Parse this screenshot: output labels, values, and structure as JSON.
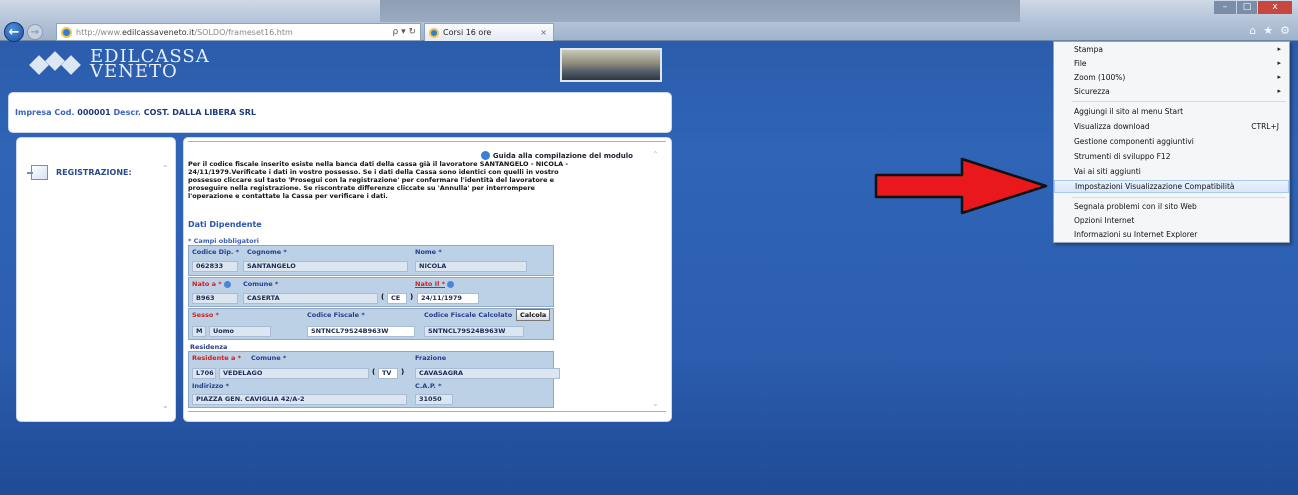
{
  "browser": {
    "url_domain": "edilcassaveneto.it",
    "url_prefix": "http://www.",
    "url_path": "/SOLDO/frameset16.htm",
    "tab_title": "Corsi 16 ore",
    "tab_close": "×",
    "search_glyph": "ρ ▾ ↻",
    "window_controls": {
      "minimize": "–",
      "maximize": "□",
      "close": "x"
    },
    "top_icons": {
      "home": "⌂",
      "favorites": "★",
      "tools": "⚙"
    }
  },
  "site": {
    "logo_line1": "EDILCASSA",
    "logo_line2": "VENETO"
  },
  "header": {
    "company_label": "Impresa Cod.",
    "company_code": "000001",
    "descr_label": "Descr.",
    "descr_value": "COST. DALLA LIBERA SRL"
  },
  "sidebar": {
    "item_label": "REGISTRAZIONE:",
    "scroll_up": "⌃",
    "scroll_down": "⌄"
  },
  "form": {
    "guide_link": "Guida alla compilazione del modulo",
    "message": "Per il codice fiscale inserito esiste nella banca dati della cassa già il lavoratore SANTANGELO - NICOLA - 24/11/1979.Verificate i dati in vostro possesso. Se i dati della Cassa sono identici con quelli in vostro possesso cliccare sul tasto 'Prosegui con la registrazione' per confermare l'identità del lavoratore e proseguire nella registrazione. Se riscontrate differenze cliccate su 'Annulla' per interrompere l'operazione e contattate la Cassa per verificare i dati.",
    "section_title": "Dati Dipendente",
    "required_note": "* Campi obbligatori",
    "labels": {
      "codice_dip": "Codice Dip. *",
      "cognome": "Cognome *",
      "nome": "Nome *",
      "nato_a": "Nato a *",
      "comune": "Comune *",
      "nato_il": "Nato Il *",
      "sesso": "Sesso *",
      "codice_fiscale": "Codice Fiscale *",
      "cf_calcolato": "Codice Fiscale Calcolato",
      "residenza": "Residenza",
      "residente_a": "Residente a *",
      "comune_res": "Comune *",
      "frazione": "Frazione",
      "indirizzo": "Indirizzo *",
      "cap": "C.A.P. *"
    },
    "values": {
      "codice_dip": "062833",
      "cognome": "SANTANGELO",
      "nome": "NICOLA",
      "nato_a_code": "B963",
      "nato_a_comune": "CASERTA",
      "nato_a_prov": "CE",
      "nato_il": "24/11/1979",
      "sesso_code": "M",
      "sesso_desc": "Uomo",
      "codice_fiscale": "SNTNCL79S24B963W",
      "cf_calcolato": "SNTNCL79S24B963W",
      "res_code": "L706",
      "res_comune": "VEDELAGO",
      "res_prov": "TV",
      "frazione": "CAVASAGRA",
      "indirizzo": "PIAZZA GEN. CAVIGLIA 42/A-2",
      "cap": "31050"
    },
    "calcola_button": "Calcola",
    "paren_open": "(",
    "paren_close": ")"
  },
  "tools_menu": {
    "items": [
      {
        "label": "Stampa",
        "submenu": true
      },
      {
        "label": "File",
        "submenu": true
      },
      {
        "label": "Zoom (100%)",
        "submenu": true
      },
      {
        "label": "Sicurezza",
        "submenu": true
      },
      {
        "label": "Aggiungi il sito al menu Start"
      },
      {
        "label": "Visualizza download",
        "shortcut": "CTRL+J"
      },
      {
        "label": "Gestione componenti aggiuntivi"
      },
      {
        "label": "Strumenti di sviluppo F12"
      },
      {
        "label": "Vai ai siti aggiunti"
      },
      {
        "label": "Impostazioni Visualizzazione Compatibilità",
        "highlighted": true
      },
      {
        "label": "Segnala problemi con il sito Web"
      },
      {
        "label": "Opzioni Internet"
      },
      {
        "label": "Informazioni su Internet Explorer"
      }
    ],
    "submenu_arrow": "▸"
  },
  "annotation": {
    "arrow_color": "#e8181c"
  }
}
